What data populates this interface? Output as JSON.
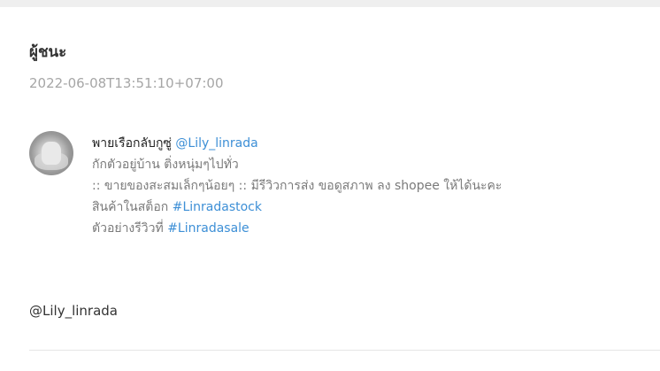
{
  "post": {
    "title": "ผู้ชนะ",
    "timestamp": "2022-06-08T13:51:10+07:00"
  },
  "profile": {
    "avatar_icon": "profile-photo",
    "name": "พายเรือกลับกูซู่",
    "handle": "@Lily_linrada",
    "bio_line1": "กักตัวอยู่บ้าน ติ่งหนุ่มๆไปทั่ว",
    "bio_line2": ":: ขายของสะสมเล็กๆน้อยๆ :: มีรีวิวการส่ง ขอดูสภาพ ลง shopee ให้ได้นะคะ",
    "stock_label": "สินค้าในสต็อก",
    "stock_tag": "#Linradastock",
    "sale_label": "ตัวอย่างรีวิวที่",
    "sale_tag": "#Linradasale"
  },
  "footer": {
    "mention": "@Lily_linrada"
  },
  "colors": {
    "link": "#3d8fd6",
    "muted": "#7a7a7a",
    "top_band": "#efefef"
  }
}
